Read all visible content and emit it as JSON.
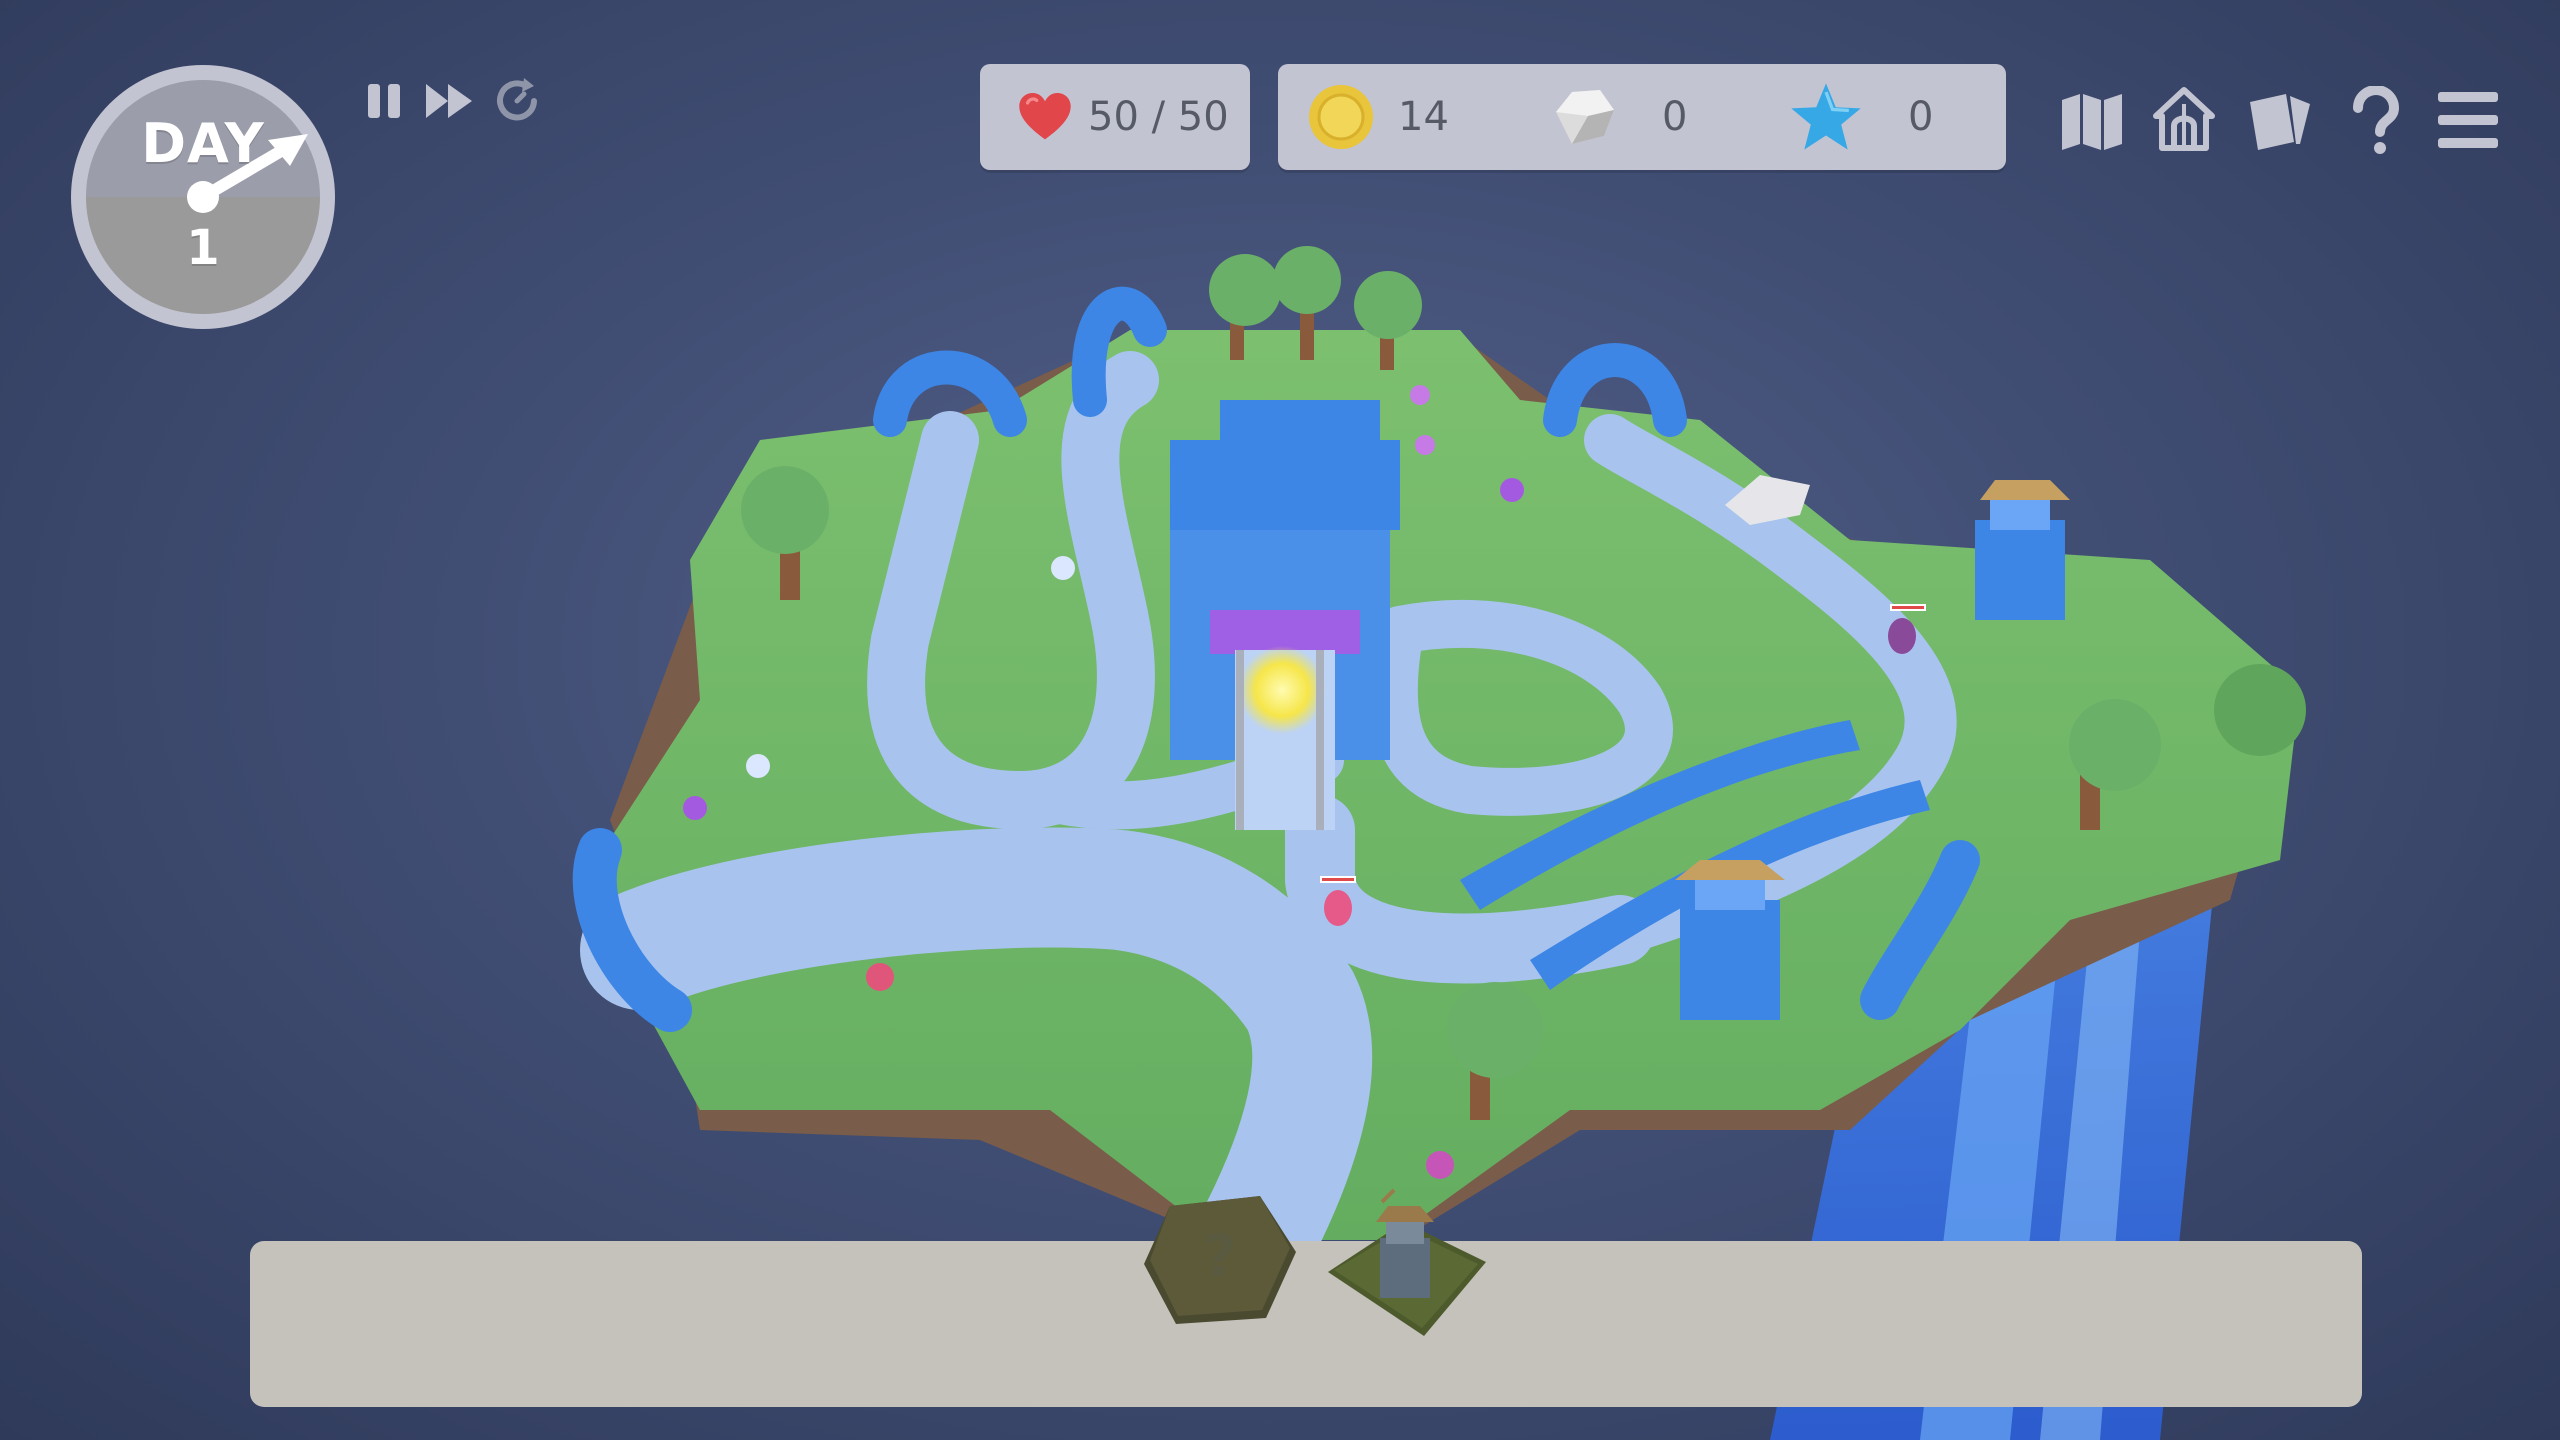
{
  "clock": {
    "day_label": "DAY",
    "day_number": "1"
  },
  "controls": {
    "pause_icon": "pause-icon",
    "fast_forward_icon": "fast-forward-icon",
    "auto_speed_icon": "auto-speed-icon"
  },
  "resources": {
    "health": {
      "icon": "heart-icon",
      "value": "50 / 50"
    },
    "gold": {
      "icon": "gold-coin-icon",
      "value": "14"
    },
    "stone": {
      "icon": "stone-icon",
      "value": "0"
    },
    "stars": {
      "icon": "star-icon",
      "value": "0"
    }
  },
  "menu": {
    "items": [
      {
        "icon": "map-icon"
      },
      {
        "icon": "castle-upgrades-icon"
      },
      {
        "icon": "cards-deck-icon"
      },
      {
        "icon": "help-icon"
      },
      {
        "icon": "hamburger-menu-icon"
      }
    ]
  },
  "hand": {
    "mystery_card_label": "?"
  },
  "colors": {
    "background": "#414e74",
    "panel": "#c3c4d2",
    "hand_bar": "#c5c2bc",
    "grass": "#6fb569",
    "path": "#a8c4ee",
    "castle_blue": "#3d86e6",
    "gate_purple": "#a060e6",
    "clock_gray": "#9d9d9d"
  }
}
